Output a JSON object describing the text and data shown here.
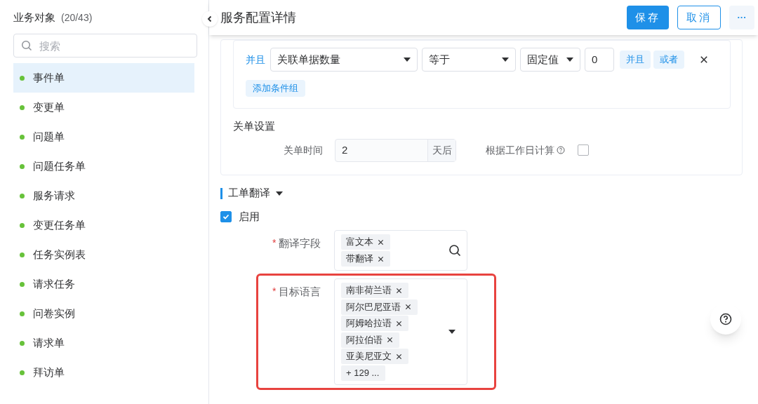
{
  "sidebar": {
    "title": "业务对象",
    "count": "(20/43)",
    "search": {
      "placeholder": "搜索"
    },
    "items": [
      {
        "label": "事件单",
        "selected": true,
        "color": "#67c23a"
      },
      {
        "label": "变更单",
        "selected": false,
        "color": "#67c23a"
      },
      {
        "label": "问题单",
        "selected": false,
        "color": "#67c23a"
      },
      {
        "label": "问题任务单",
        "selected": false,
        "color": "#67c23a"
      },
      {
        "label": "服务请求",
        "selected": false,
        "color": "#67c23a"
      },
      {
        "label": "变更任务单",
        "selected": false,
        "color": "#67c23a"
      },
      {
        "label": "任务实例表",
        "selected": false,
        "color": "#67c23a"
      },
      {
        "label": "请求任务",
        "selected": false,
        "color": "#67c23a"
      },
      {
        "label": "问卷实例",
        "selected": false,
        "color": "#67c23a"
      },
      {
        "label": "请求单",
        "selected": false,
        "color": "#67c23a"
      },
      {
        "label": "拜访单",
        "selected": false,
        "color": "#67c23a"
      }
    ]
  },
  "header": {
    "title": "服务配置详情",
    "buttons": [
      {
        "label": "保存",
        "kind": "primary"
      },
      {
        "label": "取消",
        "kind": "outline"
      },
      {
        "label": "···",
        "kind": "more"
      }
    ]
  },
  "condition": {
    "logic": "并且",
    "field": "关联单据数量",
    "operator": "等于",
    "value_type": "固定值",
    "value": "0",
    "ops": [
      "并且",
      "或者"
    ],
    "add_group": "添加条件组"
  },
  "close_settings": {
    "title": "关单设置",
    "time_label": "关单时间",
    "time_value": "2",
    "time_unit": "天后",
    "workday_label": "根据工作日计算",
    "workday_checked": false
  },
  "translation": {
    "title": "工单翻译",
    "enabled_label": "启用",
    "enabled": true,
    "required_mark": "*",
    "fields_label": "翻译字段",
    "fields_required": true,
    "languages_required": true,
    "fields": [
      "富文本",
      "带翻译"
    ],
    "languages_label": "目标语言",
    "languages": [
      "南非荷兰语",
      "阿尔巴尼亚语",
      "阿姆哈拉语",
      "阿拉伯语",
      "亚美尼亚文"
    ],
    "languages_more": "+ 129 ..."
  }
}
